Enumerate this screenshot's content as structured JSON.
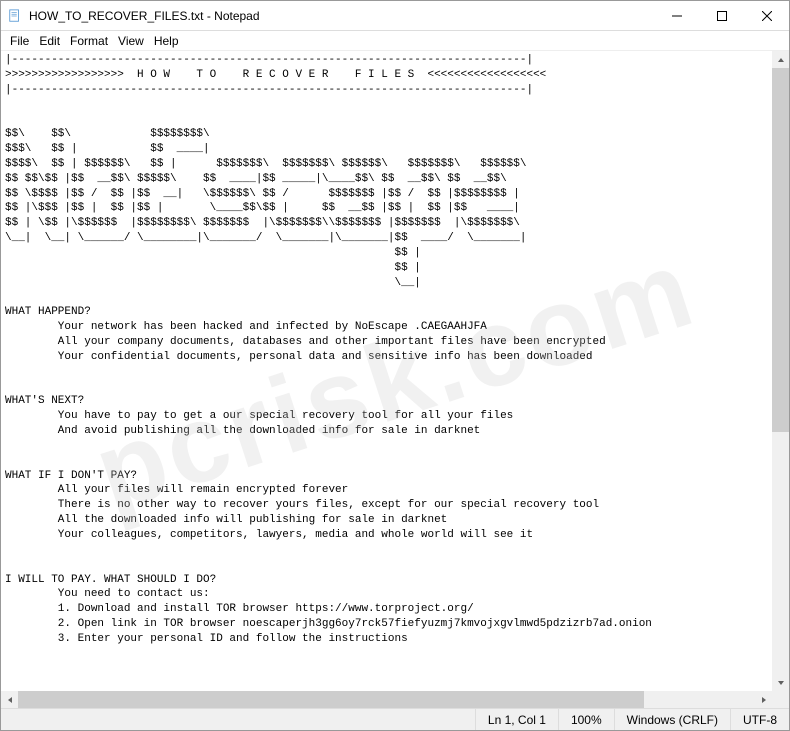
{
  "window": {
    "title": "HOW_TO_RECOVER_FILES.txt - Notepad"
  },
  "menu": {
    "file": "File",
    "edit": "Edit",
    "format": "Format",
    "view": "View",
    "help": "Help"
  },
  "content": {
    "text": "|------------------------------------------------------------------------------|\n>>>>>>>>>>>>>>>>>>  H O W    T O    R E C O V E R    F I L E S  <<<<<<<<<<<<<<<<<<\n|------------------------------------------------------------------------------|\n\n\n$$\\    $$\\            $$$$$$$$\\\n$$$\\   $$ |           $$  ____|\n$$$$\\  $$ | $$$$$$\\   $$ |      $$$$$$$\\  $$$$$$$\\ $$$$$$\\   $$$$$$$\\   $$$$$$\\\n$$ $$\\$$ |$$  __$$\\ $$$$$\\    $$  ____|$$ _____|\\____$$\\ $$  __$$\\ $$  __$$\\\n$$ \\$$$$ |$$ /  $$ |$$  __|   \\$$$$$$\\ $$ /      $$$$$$$ |$$ /  $$ |$$$$$$$$ |\n$$ |\\$$$ |$$ |  $$ |$$ |       \\____$$\\$$ |     $$  __$$ |$$ |  $$ |$$   ____|\n$$ | \\$$ |\\$$$$$$  |$$$$$$$$\\ $$$$$$$  |\\$$$$$$$\\\\$$$$$$$ |$$$$$$$  |\\$$$$$$$\\\n\\__|  \\__| \\______/ \\________|\\_______/  \\_______|\\_______|$$  ____/  \\_______|\n                                                           $$ |\n                                                           $$ |\n                                                           \\__|\n\nWHAT HAPPEND?\n        Your network has been hacked and infected by NoEscape .CAEGAAHJFA\n        All your company documents, databases and other important files have been encrypted\n        Your confidential documents, personal data and sensitive info has been downloaded\n\n\nWHAT'S NEXT?\n        You have to pay to get a our special recovery tool for all your files\n        And avoid publishing all the downloaded info for sale in darknet\n\n\nWHAT IF I DON'T PAY?\n        All your files will remain encrypted forever\n        There is no other way to recover yours files, except for our special recovery tool\n        All the downloaded info will publishing for sale in darknet\n        Your colleagues, competitors, lawyers, media and whole world will see it\n\n\nI WILL TO PAY. WHAT SHOULD I DO?\n        You need to contact us:\n        1. Download and install TOR browser https://www.torproject.org/\n        2. Open link in TOR browser noescaperjh3gg6oy7rck57fiefyuzmj7kmvojxgvlmwd5pdzizrb7ad.onion\n        3. Enter your personal ID and follow the instructions"
  },
  "status": {
    "position": "Ln 1, Col 1",
    "zoom": "100%",
    "lineending": "Windows (CRLF)",
    "encoding": "UTF-8"
  },
  "watermark": "pcrisk.com"
}
